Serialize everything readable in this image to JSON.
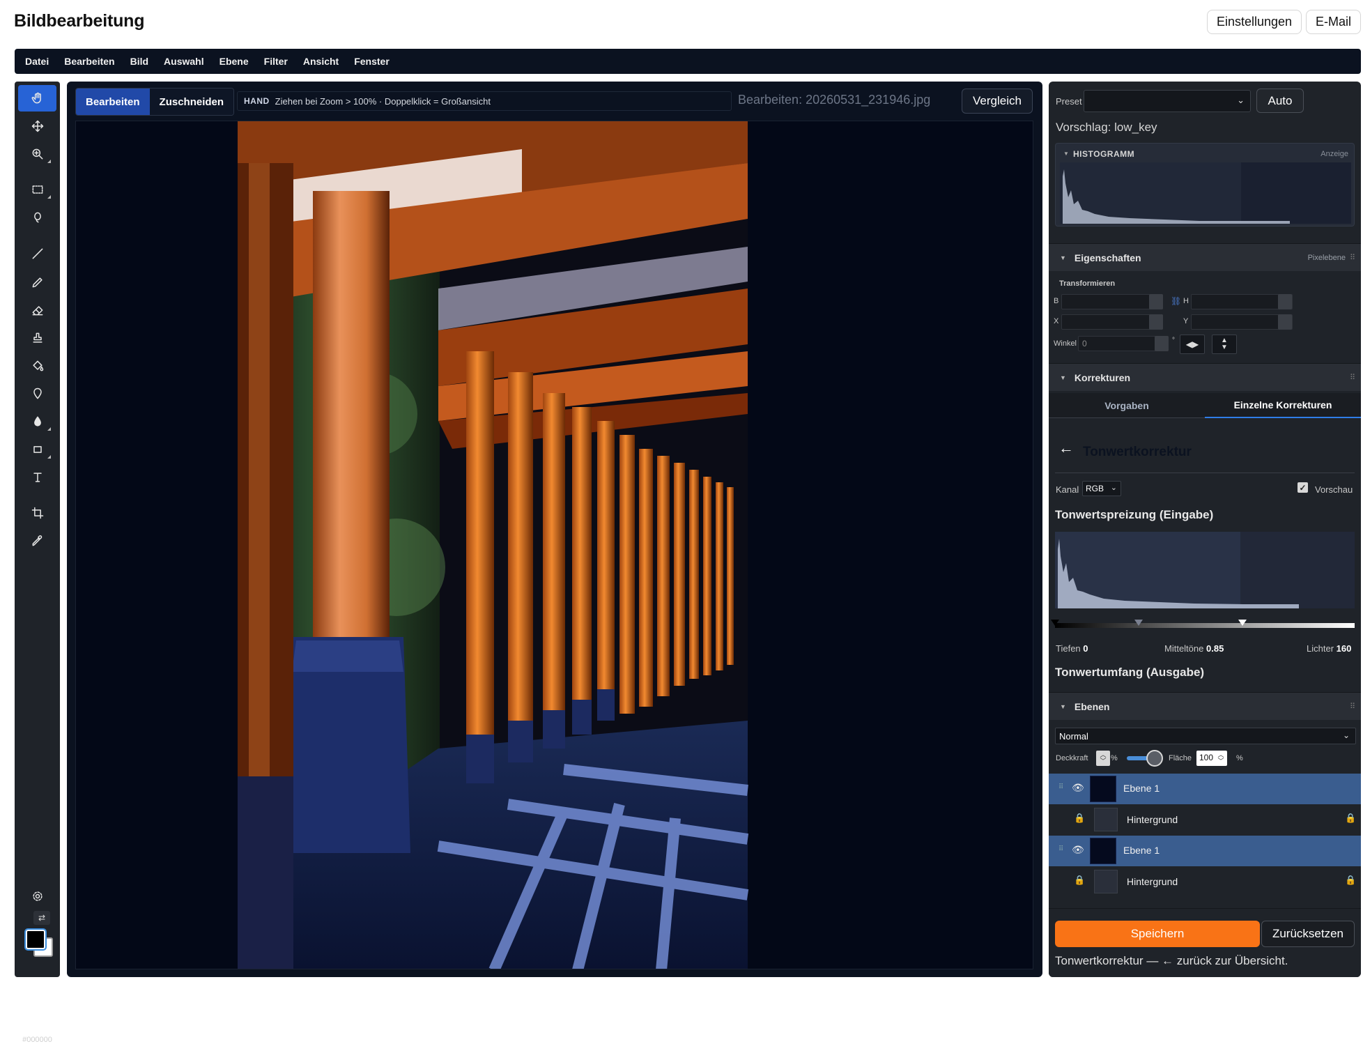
{
  "app": {
    "title": "Bildbearbeitung",
    "settings_label": "Einstellungen",
    "email_label": "E-Mail"
  },
  "menu": [
    "Datei",
    "Bearbeiten",
    "Bild",
    "Auswahl",
    "Ebene",
    "Filter",
    "Ansicht",
    "Fenster"
  ],
  "tools": [
    "hand-icon",
    "move-icon",
    "zoom-icon",
    "marquee-select-icon",
    "lasso-icon",
    "line-icon",
    "pencil-icon",
    "eraser-icon",
    "stamp-icon",
    "fill-bucket-icon",
    "pen-tool-icon",
    "blur-drop-icon",
    "rectangle-icon",
    "text-icon",
    "crop-icon",
    "eyedropper-icon",
    "settings-gear-icon"
  ],
  "color": {
    "foreground": "#000000",
    "hex_label": "#000000"
  },
  "editor": {
    "mode_edit": "Bearbeiten",
    "mode_crop": "Zuschneiden",
    "hint_tag": "HAND",
    "hint_text": "Ziehen bei Zoom > 100% · Doppelklick = Großansicht",
    "file_label": "Bearbeiten: 20260531_231946.jpg",
    "compare_label": "Vergleich"
  },
  "right": {
    "preset_label": "Preset",
    "preset_value": "",
    "auto_label": "Auto",
    "suggestion": "Vorschlag: low_key",
    "histogram_title": "HISTOGRAMM",
    "histogram_extra": "Anzeige",
    "properties": {
      "title": "Eigenschaften",
      "extra": "Pixelebene",
      "transform_label": "Transformieren",
      "b_label": "B",
      "h_label": "H",
      "x_label": "X",
      "y_label": "Y",
      "angle_label": "Winkel",
      "angle_value": "0",
      "degree": "°"
    },
    "corrections": {
      "title": "Korrekturen",
      "tab_presets": "Vorgaben",
      "tab_single": "Einzelne Korrekturen",
      "back_arrow": "←",
      "panel_title": "Tonwertkorrektur",
      "channel_label": "Kanal",
      "channel_value": "RGB",
      "preview_label": "Vorschau",
      "preview_checked": true,
      "input_title": "Tonwertspreizung (Eingabe)",
      "shadows_label": "Tiefen",
      "shadows_value": "0",
      "midtones_label": "Mitteltöne",
      "midtones_value": "0.85",
      "highlights_label": "Lichter",
      "highlights_value": "160",
      "output_title": "Tonwertumfang (Ausgabe)"
    },
    "layers": {
      "title": "Ebenen",
      "blend_mode": "Normal",
      "opacity_label": "Deckkraft",
      "opacity_unit": "%",
      "fill_label": "Fläche",
      "fill_value": "100",
      "fill_unit": "%",
      "items": [
        {
          "name": "Ebene 1",
          "selected": true
        },
        {
          "name": "Hintergrund",
          "selected": false
        },
        {
          "name": "Ebene 1",
          "selected": true
        },
        {
          "name": "Hintergrund",
          "selected": false
        }
      ]
    },
    "save_label": "Speichern",
    "reset_label": "Zurücksetzen",
    "status_text": "Tonwertkorrektur — ← zurück zur Übersicht."
  }
}
